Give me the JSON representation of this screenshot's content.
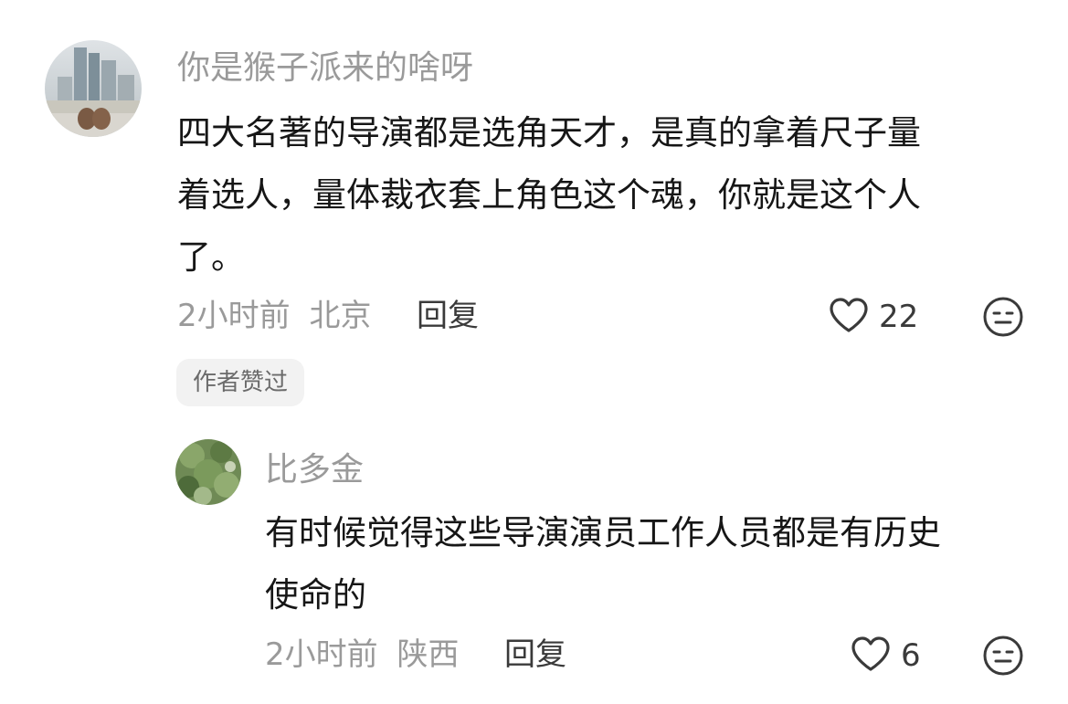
{
  "comments": [
    {
      "username": "你是猴子派来的啥呀",
      "content_lines": [
        "四大名著的导演都是选角天才，是真的拿着尺子量",
        "着选人，量体裁衣套上角色这个魂，你就是这个人",
        "了。"
      ],
      "time": "2小时前",
      "location": "北京",
      "reply_label": "回复",
      "like_count": "22",
      "badge": "作者赞过"
    },
    {
      "username": "比多金",
      "content_lines": [
        "有时候觉得这些导演演员工作人员都是有历史",
        "使命的"
      ],
      "time": "2小时前",
      "location": "陕西",
      "reply_label": "回复",
      "like_count": "6"
    }
  ],
  "icons": {
    "like": "heart-outline-icon",
    "reaction": "meh-face-icon"
  },
  "colors": {
    "username": "#9a9a9a",
    "text": "#161616",
    "meta": "#9a9a9a",
    "badge_bg": "#f2f2f2"
  }
}
